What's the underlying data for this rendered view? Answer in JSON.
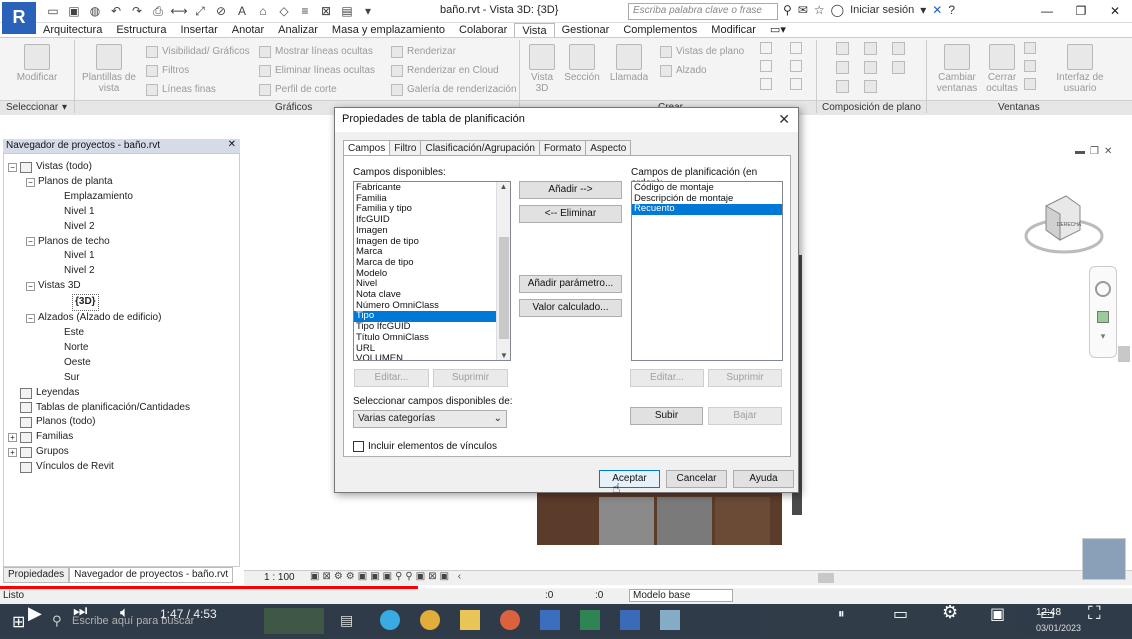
{
  "app": {
    "logo_letter": "R",
    "doc_title": "baño.rvt - Vista 3D: {3D}",
    "search_placeholder": "Escriba palabra clave o frase",
    "sign_in": "Iniciar sesión"
  },
  "ribbon_tabs": [
    "Arquitectura",
    "Estructura",
    "Insertar",
    "Anotar",
    "Analizar",
    "Masa y emplazamiento",
    "Colaborar",
    "Vista",
    "Gestionar",
    "Complementos",
    "Modificar"
  ],
  "ribbon": {
    "modify": "Modificar",
    "view_templates": "Plantillas de vista",
    "visibility": "Visibilidad/ Gráficos",
    "filters": "Filtros",
    "thin_lines": "Líneas finas",
    "show_hidden": "Mostrar líneas ocultas",
    "remove_hidden": "Eliminar líneas ocultas",
    "cut_profile": "Perfil de corte",
    "render": "Renderizar",
    "render_cloud": "Renderizar en Cloud",
    "render_gallery": "Galería de renderización",
    "view_3d": "Vista 3D",
    "section": "Sección",
    "callout": "Llamada",
    "plan_views": "Vistas de plano",
    "elevation": "Alzado",
    "switch_windows": "Cambiar ventanas",
    "close_hidden": "Cerrar ocultas",
    "user_interface": "Interfaz de usuario",
    "panel_select": "Seleccionar",
    "panel_graphics": "Gráficos",
    "panel_create": "Crear",
    "panel_sheet": "Composición de plano",
    "panel_windows": "Ventanas"
  },
  "navigator": {
    "title": "Navegador de proyectos - baño.rvt",
    "tree": [
      {
        "label": "Vistas (todo)",
        "level": 0,
        "toggle": "−",
        "bold": false
      },
      {
        "label": "Planos de planta",
        "level": 1,
        "toggle": "−",
        "bold": false
      },
      {
        "label": "Emplazamiento",
        "level": 2,
        "toggle": "",
        "bold": false
      },
      {
        "label": "Nivel 1",
        "level": 2,
        "toggle": "",
        "bold": false
      },
      {
        "label": "Nivel 2",
        "level": 2,
        "toggle": "",
        "bold": false
      },
      {
        "label": "Planos de techo",
        "level": 1,
        "toggle": "−",
        "bold": false
      },
      {
        "label": "Nivel 1",
        "level": 2,
        "toggle": "",
        "bold": false
      },
      {
        "label": "Nivel 2",
        "level": 2,
        "toggle": "",
        "bold": false
      },
      {
        "label": "Vistas 3D",
        "level": 1,
        "toggle": "−",
        "bold": false
      },
      {
        "label": "{3D}",
        "level": 2,
        "toggle": "",
        "bold": true
      },
      {
        "label": "Alzados (Alzado de edificio)",
        "level": 1,
        "toggle": "−",
        "bold": false
      },
      {
        "label": "Este",
        "level": 2,
        "toggle": "",
        "bold": false
      },
      {
        "label": "Norte",
        "level": 2,
        "toggle": "",
        "bold": false
      },
      {
        "label": "Oeste",
        "level": 2,
        "toggle": "",
        "bold": false
      },
      {
        "label": "Sur",
        "level": 2,
        "toggle": "",
        "bold": false
      },
      {
        "label": "Leyendas",
        "level": 0,
        "toggle": "",
        "bold": false
      },
      {
        "label": "Tablas de planificación/Cantidades",
        "level": 0,
        "toggle": "",
        "bold": false
      },
      {
        "label": "Planos (todo)",
        "level": 0,
        "toggle": "",
        "bold": false
      },
      {
        "label": "Familias",
        "level": 0,
        "toggle": "+",
        "bold": false
      },
      {
        "label": "Grupos",
        "level": 0,
        "toggle": "+",
        "bold": false
      },
      {
        "label": "Vínculos de Revit",
        "level": 0,
        "toggle": "",
        "bold": false
      }
    ],
    "tab_properties": "Propiedades",
    "tab_navigator": "Navegador de proyectos - baño.rvt"
  },
  "viewbar": {
    "scale": "1 : 100"
  },
  "status": {
    "text": "Listo",
    "zero1": ":0",
    "zero2": ":0",
    "model": "Modelo base"
  },
  "video": {
    "time": "1:47 / 4:53",
    "progress": 0.369
  },
  "taskbar": {
    "search_placeholder": "Escribe aquí para buscar",
    "clock": "12:48",
    "date": "03/01/2023"
  },
  "dialog": {
    "title": "Propiedades de tabla de planificación",
    "tabs": [
      "Campos",
      "Filtro",
      "Clasificación/Agrupación",
      "Formato",
      "Aspecto"
    ],
    "available_label": "Campos disponibles:",
    "available": [
      "Fabricante",
      "Familia",
      "Familia y tipo",
      "IfcGUID",
      "Imagen",
      "Imagen de tipo",
      "Marca",
      "Marca de tipo",
      "Modelo",
      "Nivel",
      "Nota clave",
      "Número OmniClass",
      "Tipo",
      "Tipo IfcGUID",
      "Título OmniClass",
      "URL",
      "VOLUMEN"
    ],
    "available_selected": "Tipo",
    "schedule_label": "Campos de planificación (en orden):",
    "schedule": [
      "Código de montaje",
      "Descripción de montaje",
      "Recuento"
    ],
    "schedule_selected": "Recuento",
    "btn_add": "Añadir -->",
    "btn_remove": "<-- Eliminar",
    "btn_add_param": "Añadir parámetro...",
    "btn_calc": "Valor calculado...",
    "btn_edit": "Editar...",
    "btn_delete": "Suprimir",
    "select_from_label": "Seleccionar campos disponibles de:",
    "select_from_value": "Varias categorías",
    "include_links": "Incluir elementos de vínculos",
    "btn_up": "Subir",
    "btn_down": "Bajar",
    "btn_ok": "Aceptar",
    "btn_cancel": "Cancelar",
    "btn_help": "Ayuda"
  },
  "viewcube": {
    "face": "DERECHA"
  },
  "colors": {
    "accent": "#2b62b9",
    "selection": "#0078d7",
    "progress": "#ff0000"
  }
}
